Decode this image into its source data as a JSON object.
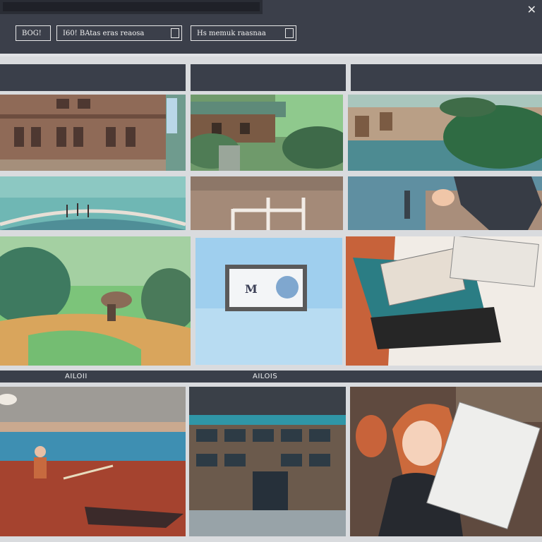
{
  "window": {
    "close_glyph": "✕"
  },
  "toolbar": {
    "field_1": "BOG!",
    "field_2": "I60! BAtas eras reaosa",
    "field_3": "Hs memuk raasnaa"
  },
  "captions": {
    "left": "AILOII",
    "right": "AILOIS"
  },
  "tiles": [
    {
      "name": "tile-brick-building",
      "icon": "building-icon"
    },
    {
      "name": "tile-garden-house",
      "icon": "house-icon"
    },
    {
      "name": "tile-river-landscape",
      "icon": "river-icon"
    },
    {
      "name": "tile-bridge",
      "icon": "bridge-icon"
    },
    {
      "name": "tile-fence",
      "icon": "fence-icon"
    },
    {
      "name": "tile-person-by-water",
      "icon": "person-icon"
    },
    {
      "name": "tile-park-path",
      "icon": "park-icon"
    },
    {
      "name": "tile-photo-frame",
      "icon": "photo-frame-icon"
    },
    {
      "name": "tile-reading-papers",
      "icon": "document-icon"
    },
    {
      "name": "tile-stadium-runner",
      "icon": "stadium-icon"
    },
    {
      "name": "tile-building-facade",
      "icon": "building-icon"
    },
    {
      "name": "tile-woman-with-book",
      "icon": "book-icon"
    }
  ],
  "tile_photo": {
    "text": "M"
  },
  "colors": {
    "toolbar_bg": "#3b3f4a",
    "divider": "#e2e3e6",
    "tile_gap": "#d9dbde"
  }
}
